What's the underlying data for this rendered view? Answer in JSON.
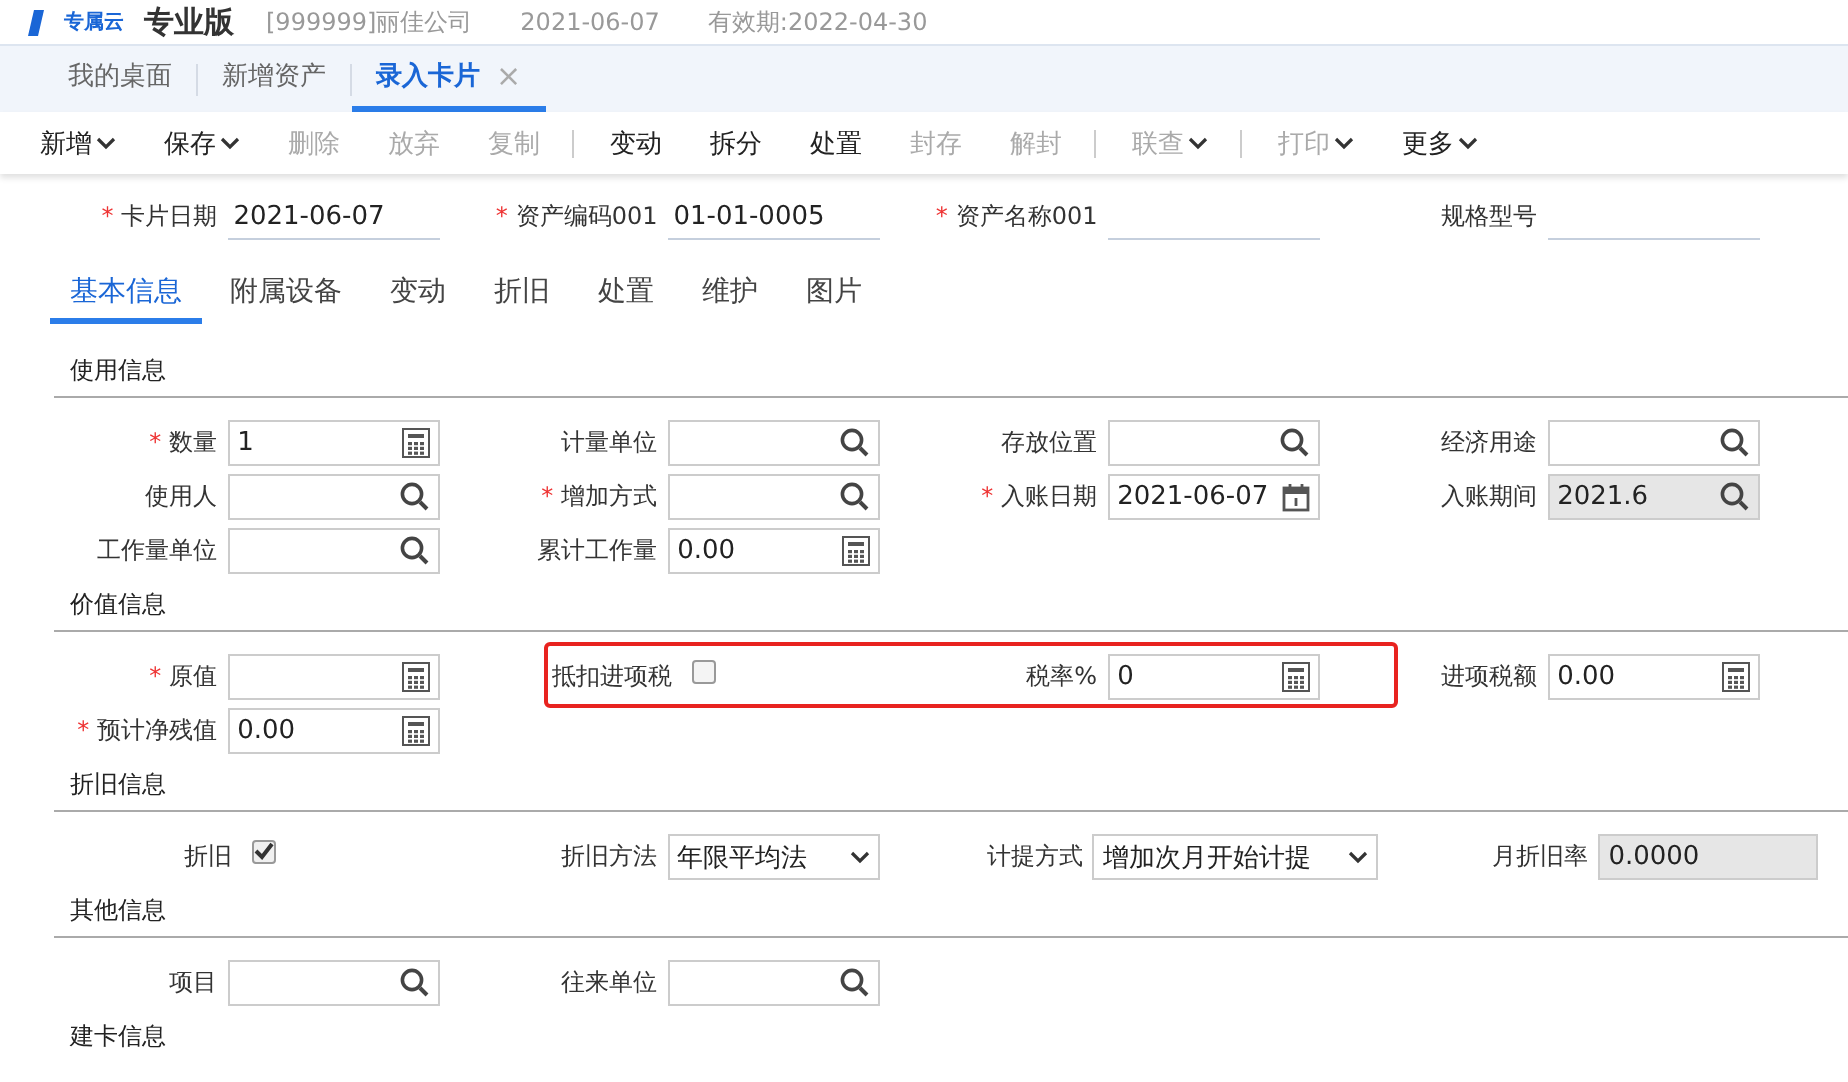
{
  "header": {
    "logo_caption": "专属云",
    "edition": "专业版",
    "company": "[999999]丽佳公司",
    "date": "2021-06-07",
    "validity": "有效期:2022-04-30"
  },
  "tabs": [
    {
      "label": "我的桌面",
      "selected": false
    },
    {
      "label": "新增资产",
      "selected": false
    },
    {
      "label": "录入卡片",
      "selected": true,
      "close": "×"
    }
  ],
  "toolbar": [
    {
      "kind": "button",
      "label": "新增",
      "dropdown": true,
      "disabled": false
    },
    {
      "kind": "button",
      "label": "保存",
      "dropdown": true,
      "disabled": false
    },
    {
      "kind": "button",
      "label": "删除",
      "dropdown": false,
      "disabled": true
    },
    {
      "kind": "button",
      "label": "放弃",
      "dropdown": false,
      "disabled": true
    },
    {
      "kind": "button",
      "label": "复制",
      "dropdown": false,
      "disabled": true
    },
    {
      "kind": "separator"
    },
    {
      "kind": "button",
      "label": "变动",
      "dropdown": false,
      "disabled": false
    },
    {
      "kind": "button",
      "label": "拆分",
      "dropdown": false,
      "disabled": false
    },
    {
      "kind": "button",
      "label": "处置",
      "dropdown": false,
      "disabled": false
    },
    {
      "kind": "button",
      "label": "封存",
      "dropdown": false,
      "disabled": true
    },
    {
      "kind": "button",
      "label": "解封",
      "dropdown": false,
      "disabled": true
    },
    {
      "kind": "separator"
    },
    {
      "kind": "button",
      "label": "联查",
      "dropdown": true,
      "disabled": true
    },
    {
      "kind": "separator"
    },
    {
      "kind": "button",
      "label": "打印",
      "dropdown": true,
      "disabled": true
    },
    {
      "kind": "button",
      "label": "更多",
      "dropdown": true,
      "disabled": false
    }
  ],
  "card_header": [
    {
      "label": "卡片日期",
      "required_mark": "*",
      "value": "2021-06-07"
    },
    {
      "label": "资产编码001",
      "required_mark": "*",
      "value": "01-01-0005"
    },
    {
      "label": "资产名称001",
      "required_mark": "*"
    },
    {
      "label": "规格型号"
    }
  ],
  "sub_tabs": [
    {
      "label": "基本信息",
      "selected": true
    },
    {
      "label": "附属设备",
      "selected": false
    },
    {
      "label": "变动",
      "selected": false
    },
    {
      "label": "折旧",
      "selected": false
    },
    {
      "label": "处置",
      "selected": false
    },
    {
      "label": "维护",
      "selected": false
    },
    {
      "label": "图片",
      "selected": false
    }
  ],
  "sections": [
    {
      "title": "使用信息",
      "rows": [
        [
          {
            "kind": "number",
            "label": "数量",
            "required_mark": "*",
            "value": "1"
          },
          {
            "kind": "lookup",
            "label": "计量单位"
          },
          {
            "kind": "lookup",
            "label": "存放位置"
          },
          {
            "kind": "lookup",
            "label": "经济用途"
          }
        ],
        [
          {
            "kind": "lookup",
            "label": "使用人"
          },
          {
            "kind": "lookup",
            "label": "增加方式",
            "required_mark": "*"
          },
          {
            "kind": "date",
            "label": "入账日期",
            "required_mark": "*",
            "value": "2021-06-07"
          },
          {
            "kind": "lookup",
            "label": "入账期间",
            "value": "2021.6",
            "disabled": true
          }
        ],
        [
          {
            "kind": "lookup",
            "label": "工作量单位"
          },
          {
            "kind": "number",
            "label": "累计工作量",
            "value": "0.00"
          }
        ]
      ]
    },
    {
      "title": "价值信息",
      "rows": [
        [
          {
            "kind": "number",
            "label": "原值",
            "required_mark": "*"
          },
          {
            "kind": "checkbox",
            "label": "抵扣进项税",
            "checked": false,
            "highlighted": true
          },
          {
            "kind": "number",
            "label": "税率%",
            "value": "0",
            "highlighted": true
          },
          {
            "kind": "number",
            "label": "进项税额",
            "value": "0.00"
          }
        ],
        [
          {
            "kind": "number",
            "label": "预计净残值",
            "required_mark": "*",
            "value": "0.00"
          }
        ]
      ]
    },
    {
      "title": "折旧信息",
      "rows": [
        [
          {
            "kind": "checkbox",
            "label": "折旧",
            "checked": true
          },
          {
            "kind": "select",
            "label": "折旧方法",
            "value": "年限平均法"
          },
          {
            "kind": "select",
            "label": "计提方式",
            "value": "增加次月开始计提"
          },
          {
            "kind": "plain",
            "label": "月折旧率",
            "value": "0.0000",
            "disabled": true
          }
        ]
      ]
    },
    {
      "title": "其他信息",
      "rows": [
        [
          {
            "kind": "lookup",
            "label": "项目"
          },
          {
            "kind": "lookup",
            "label": "往来单位"
          }
        ]
      ]
    },
    {
      "title": "建卡信息"
    }
  ]
}
